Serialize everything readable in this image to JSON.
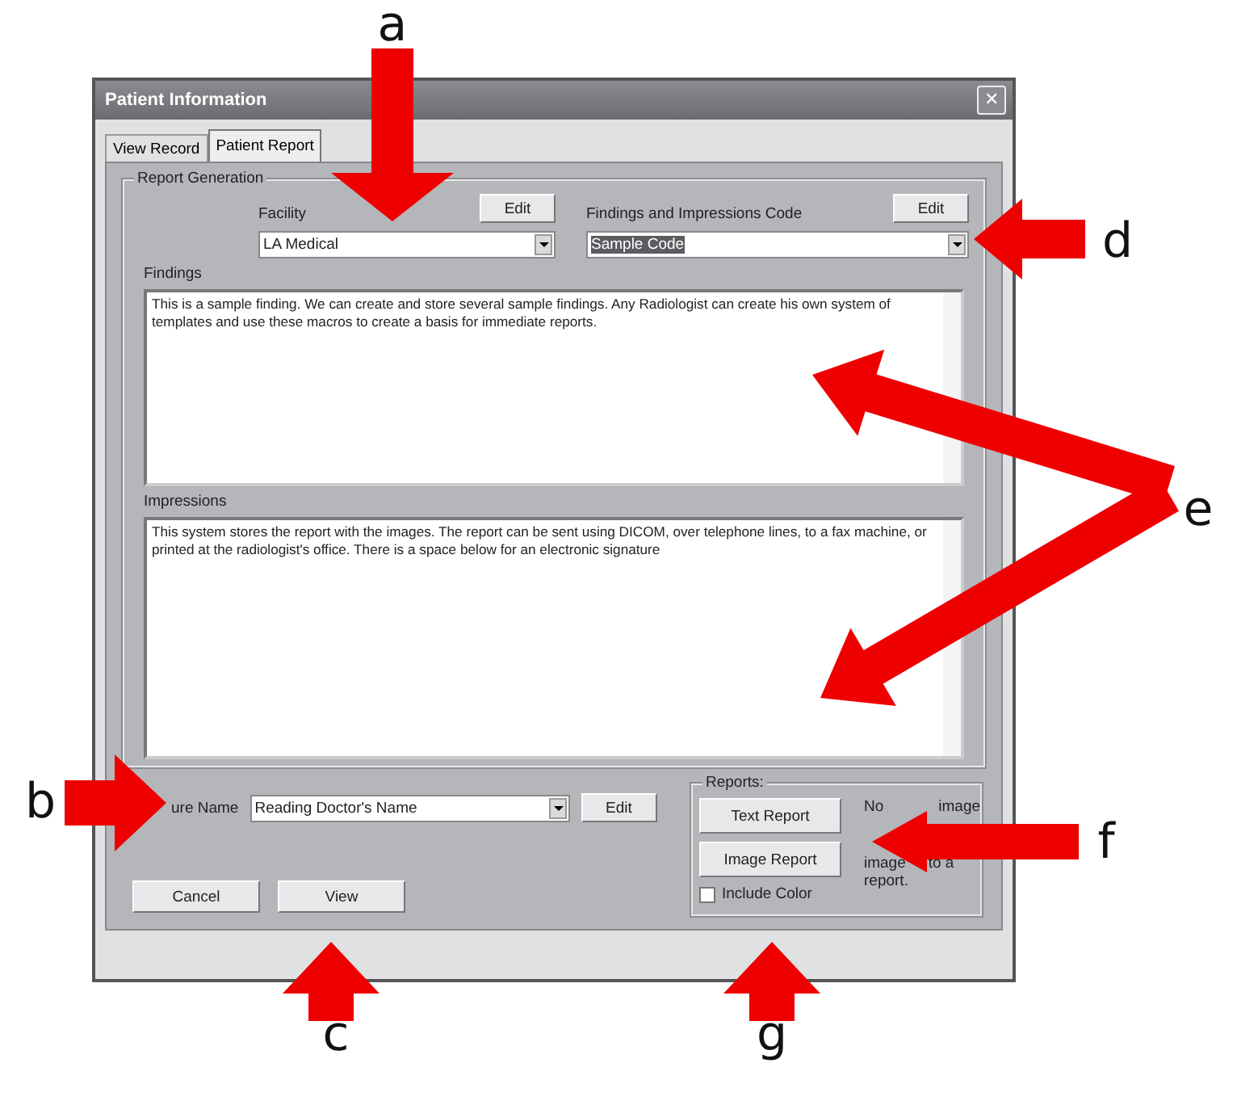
{
  "window": {
    "title": "Patient Information",
    "close": "✕"
  },
  "tabs": [
    {
      "label": "View Record",
      "selected": false
    },
    {
      "label": "Patient Report",
      "selected": true
    }
  ],
  "report_generation": {
    "title": "Report Generation",
    "facility_label": "Facility",
    "facility_edit": "Edit",
    "facility_value": "LA Medical",
    "code_label": "Findings and Impressions Code",
    "code_edit": "Edit",
    "code_value": "Sample Code",
    "findings_label": "Findings",
    "findings_text": "This is a sample finding.  We can create and store several sample findings.  Any Radiologist can create his own system of templates and use these macros to create a basis for immediate reports.",
    "impressions_label": "Impressions",
    "impressions_text": "This system stores the report with the images.  The report can be sent using DICOM, over telephone lines, to a fax machine, or printed at the radiologist's office.  There is a space below for an electronic signature"
  },
  "signature": {
    "label": "ure Name",
    "value": "Reading Doctor's Name",
    "edit": "Edit"
  },
  "reports": {
    "title": "Reports:",
    "text_report": "Text Report",
    "image_report": "Image Report",
    "include_color": {
      "label": "Include Color",
      "checked": false
    },
    "note_lines": [
      [
        "No",
        "image"
      ],
      [
        "image",
        "to a"
      ],
      [
        "report."
      ]
    ]
  },
  "buttons": [
    "Cancel",
    "View"
  ],
  "annotations": [
    {
      "label": "a"
    },
    {
      "label": "b"
    },
    {
      "label": "c"
    },
    {
      "label": "d"
    },
    {
      "label": "e"
    },
    {
      "label": "f"
    },
    {
      "label": "g"
    }
  ]
}
